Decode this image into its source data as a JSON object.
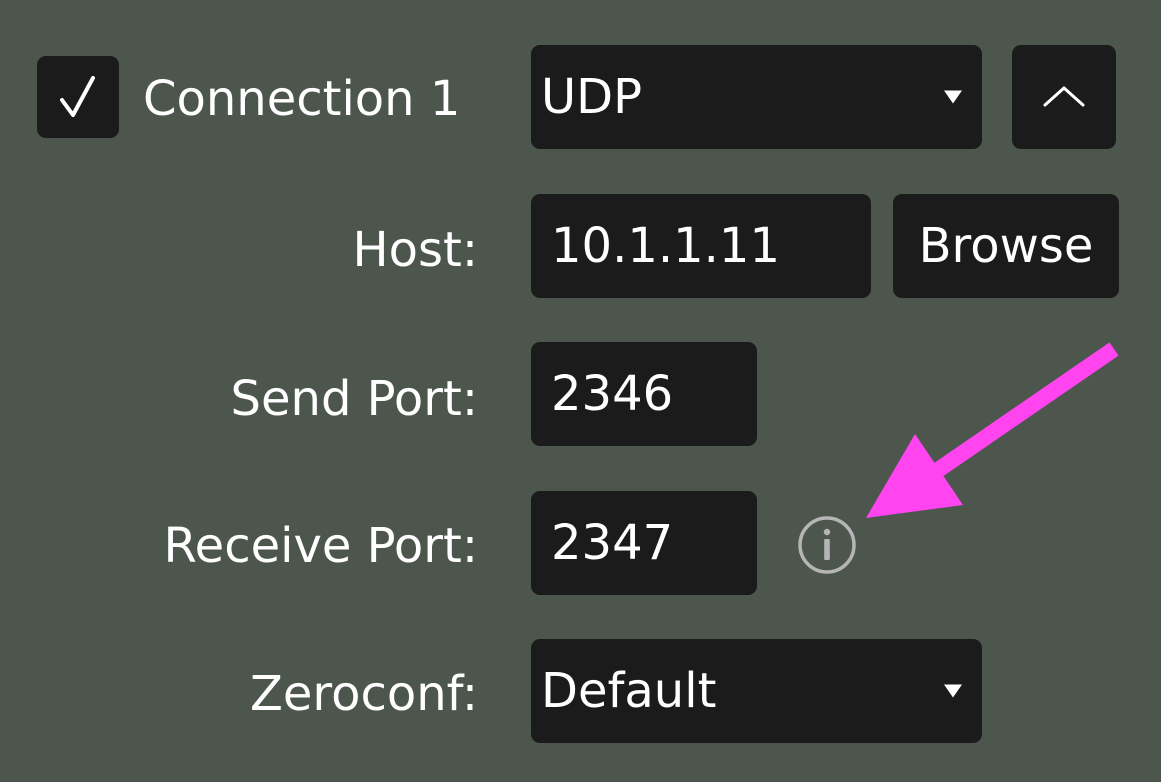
{
  "connection": {
    "enabled": true,
    "label": "Connection 1",
    "protocol": "UDP"
  },
  "host": {
    "label": "Host:",
    "value": "10.1.1.11",
    "browse_label": "Browse"
  },
  "send_port": {
    "label": "Send Port:",
    "value": "2346"
  },
  "receive_port": {
    "label": "Receive Port:",
    "value": "2347",
    "info_icon": "info-icon"
  },
  "zeroconf": {
    "label": "Zeroconf:",
    "value": "Default"
  },
  "icons": {
    "checkbox": "checkmark-icon",
    "collapse": "chevron-up-icon",
    "dropdown": "caret-down-icon",
    "annotation": "arrow-icon"
  },
  "colors": {
    "background": "#4d564d",
    "control": "#1b1b1b",
    "text": "#ffffff",
    "info_icon": "#b5b5b5",
    "annotation_arrow": "#ff44f0"
  }
}
